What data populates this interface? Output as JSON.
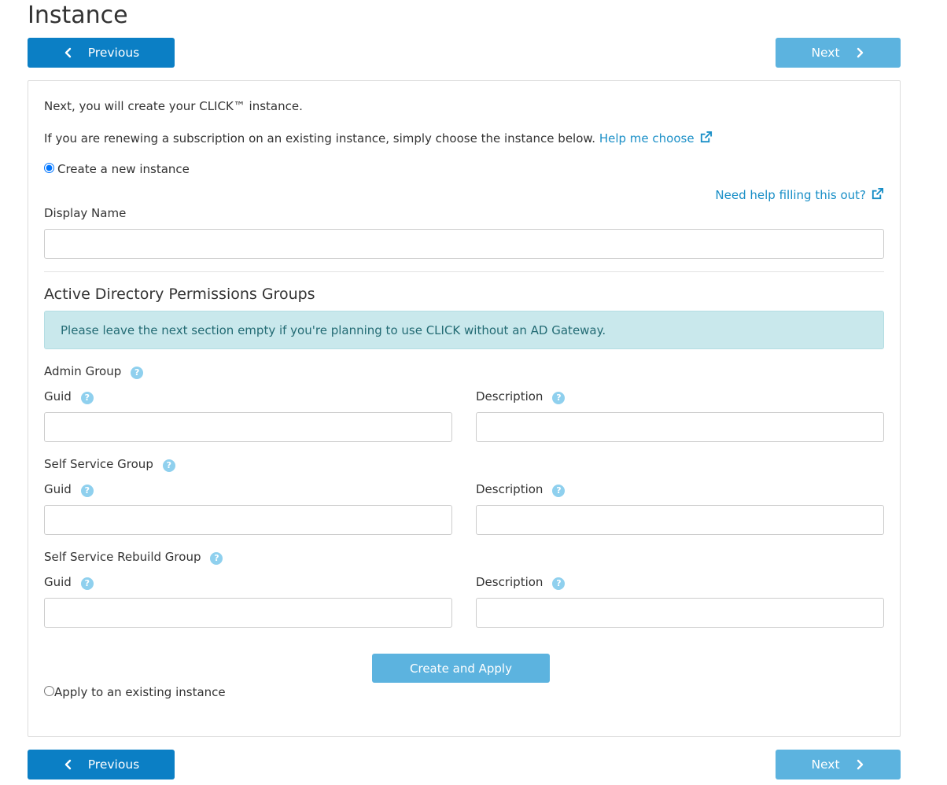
{
  "page": {
    "title": "Instance"
  },
  "nav": {
    "previous_label": "Previous",
    "next_label": "Next"
  },
  "intro": {
    "line1": "Next, you will create your CLICK™ instance.",
    "line2": "If you are renewing a subscription on an existing instance, simply choose the instance below.",
    "help_choose_link": "Help me choose"
  },
  "create_new": {
    "label": "Create a new instance",
    "selected": true
  },
  "help_fill_link": "Need help filling this out?",
  "display_name": {
    "label": "Display Name",
    "value": "",
    "placeholder": ""
  },
  "ad_section": {
    "heading": "Active Directory Permissions Groups",
    "alert": "Please leave the next section empty if you're planning to use CLICK without an AD Gateway.",
    "groups": [
      {
        "label": "Admin Group",
        "guid_label": "Guid",
        "description_label": "Description",
        "guid_value": "",
        "description_value": ""
      },
      {
        "label": "Self Service Group",
        "guid_label": "Guid",
        "description_label": "Description",
        "guid_value": "",
        "description_value": ""
      },
      {
        "label": "Self Service Rebuild Group",
        "guid_label": "Guid",
        "description_label": "Description",
        "guid_value": "",
        "description_value": ""
      }
    ]
  },
  "create_button_label": "Create and Apply",
  "apply_existing": {
    "label": "Apply to an existing instance",
    "selected": false
  },
  "icons": {
    "previous": "chevron-left-icon",
    "next": "chevron-right-icon",
    "external": "external-link-icon",
    "help": "question-circle-icon"
  },
  "colors": {
    "primary": "#0b7fc5",
    "primary_light": "#5cb3df",
    "link": "#1a8fc7",
    "alert_bg": "#c9e8ec",
    "alert_text": "#236b74",
    "help_icon": "#8fd0ee"
  }
}
